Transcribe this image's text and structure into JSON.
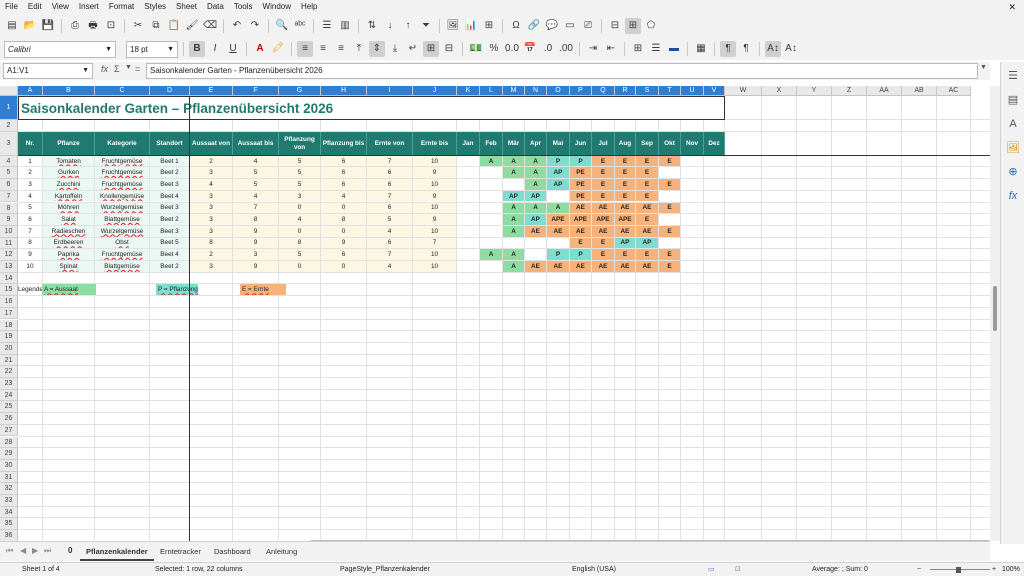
{
  "menu": [
    "File",
    "Edit",
    "View",
    "Insert",
    "Format",
    "Styles",
    "Sheet",
    "Data",
    "Tools",
    "Window",
    "Help"
  ],
  "font": {
    "name": "Calibri",
    "size": "18 pt"
  },
  "formula": {
    "cell_ref": "A1:V1",
    "fx": "fx",
    "sigma": "Σ",
    "equals": "=",
    "content": "Saisonkalender Garten - Pflanzenübersicht 2026"
  },
  "columns": [
    "A",
    "B",
    "C",
    "D",
    "E",
    "F",
    "G",
    "H",
    "I",
    "J",
    "K",
    "L",
    "M",
    "N",
    "O",
    "P",
    "Q",
    "R",
    "S",
    "T",
    "U",
    "V",
    "W",
    "X",
    "Y",
    "Z",
    "AA",
    "AB",
    "AC"
  ],
  "rows": [
    "1",
    "2",
    "3",
    "4",
    "5",
    "6",
    "7",
    "8",
    "9",
    "10",
    "11",
    "12",
    "13",
    "14",
    "15",
    "16",
    "17",
    "18",
    "19",
    "20",
    "21",
    "22",
    "23",
    "24",
    "25",
    "26",
    "27",
    "28",
    "29",
    "30",
    "31",
    "32",
    "33",
    "34",
    "35",
    "36"
  ],
  "title": "Saisonkalender Garten – Pflanzenübersicht 2026",
  "headers": [
    "Nr.",
    "Pflanze",
    "Kategorie",
    "Standort",
    "Aussaat von",
    "Aussaat bis",
    "Pflanzung von",
    "Pflanzung bis",
    "Ernte von",
    "Ernte bis",
    "Jan",
    "Feb",
    "Mär",
    "Apr",
    "Mai",
    "Jun",
    "Jul",
    "Aug",
    "Sep",
    "Okt",
    "Nov",
    "Dez"
  ],
  "plants": [
    [
      "1",
      "Tomaten",
      "Fruchtgemüse",
      "Beet 1",
      "2",
      "4",
      "5",
      "6",
      "7",
      "10"
    ],
    [
      "2",
      "Gurken",
      "Fruchtgemüse",
      "Beet 2",
      "3",
      "5",
      "5",
      "6",
      "6",
      "9"
    ],
    [
      "3",
      "Zucchini",
      "Fruchtgemüse",
      "Beet 3",
      "4",
      "5",
      "5",
      "6",
      "6",
      "10"
    ],
    [
      "4",
      "Kartoffeln",
      "Knollengemüse",
      "Beet 4",
      "3",
      "4",
      "3",
      "4",
      "7",
      "9"
    ],
    [
      "5",
      "Möhren",
      "Wurzelgemüse",
      "Beet 3",
      "3",
      "7",
      "0",
      "0",
      "6",
      "10"
    ],
    [
      "6",
      "Salat",
      "Blattgemüse",
      "Beet 2",
      "3",
      "8",
      "4",
      "8",
      "5",
      "9"
    ],
    [
      "7",
      "Radieschen",
      "Wurzelgemüse",
      "Beet 3",
      "3",
      "9",
      "0",
      "0",
      "4",
      "10"
    ],
    [
      "8",
      "Erdbeeren",
      "Obst",
      "Beet 5",
      "8",
      "9",
      "8",
      "9",
      "6",
      "7"
    ],
    [
      "9",
      "Paprika",
      "Fruchtgemüse",
      "Beet 4",
      "2",
      "3",
      "5",
      "6",
      "7",
      "10"
    ],
    [
      "10",
      "Spinat",
      "Blattgemüse",
      "Beet 2",
      "3",
      "9",
      "0",
      "0",
      "4",
      "10"
    ]
  ],
  "months": [
    [
      "",
      "A",
      "A",
      "A",
      "P",
      "P",
      "E",
      "E",
      "E",
      "E",
      "",
      ""
    ],
    [
      "",
      "",
      "A",
      "A",
      "AP",
      "PE",
      "E",
      "E",
      "E",
      "",
      "",
      ""
    ],
    [
      "",
      "",
      "",
      "A",
      "AP",
      "PE",
      "E",
      "E",
      "E",
      "E",
      "",
      ""
    ],
    [
      "",
      "",
      "AP",
      "AP",
      "",
      "PE",
      "E",
      "E",
      "E",
      "",
      "",
      ""
    ],
    [
      "",
      "",
      "A",
      "A",
      "A",
      "AE",
      "AE",
      "AE",
      "AE",
      "E",
      "",
      ""
    ],
    [
      "",
      "",
      "A",
      "AP",
      "APE",
      "APE",
      "APE",
      "APE",
      "E",
      "",
      "",
      ""
    ],
    [
      "",
      "",
      "A",
      "AE",
      "AE",
      "AE",
      "AE",
      "AE",
      "AE",
      "E",
      "",
      ""
    ],
    [
      "",
      "",
      "",
      "",
      "",
      "E",
      "E",
      "AP",
      "AP",
      "",
      "",
      ""
    ],
    [
      "",
      "A",
      "A",
      "",
      "P",
      "P",
      "E",
      "E",
      "E",
      "E",
      "",
      ""
    ],
    [
      "",
      "",
      "A",
      "AE",
      "AE",
      "AE",
      "AE",
      "AE",
      "AE",
      "E",
      "",
      ""
    ]
  ],
  "legend": {
    "label": "Legende:",
    "aussaat": "A = Aussaat",
    "pflanzung": "P = Pflanzung",
    "ernte": "E = Ernte"
  },
  "colors": {
    "header": "#217a70",
    "aussaat": "#8fdca2",
    "pflanzung": "#7fddd0",
    "ernte": "#f5b27a",
    "selection": "#2e7fd3",
    "text_col_bg": "#eaf7f3",
    "num_col_bg": "#fdf6e3"
  },
  "tabs": [
    "Pflanzenkalender",
    "Erntetracker",
    "Dashboard",
    "Anleitung"
  ],
  "tab_index": "0",
  "status": {
    "sheet": "Sheet 1 of 4",
    "selection": "Selected: 1 row, 22 columns",
    "pagestyle": "PageStyle_Pflanzenkalender",
    "language": "English (USA)",
    "summary": "Average: ; Sum: 0",
    "zoom": "100%"
  }
}
